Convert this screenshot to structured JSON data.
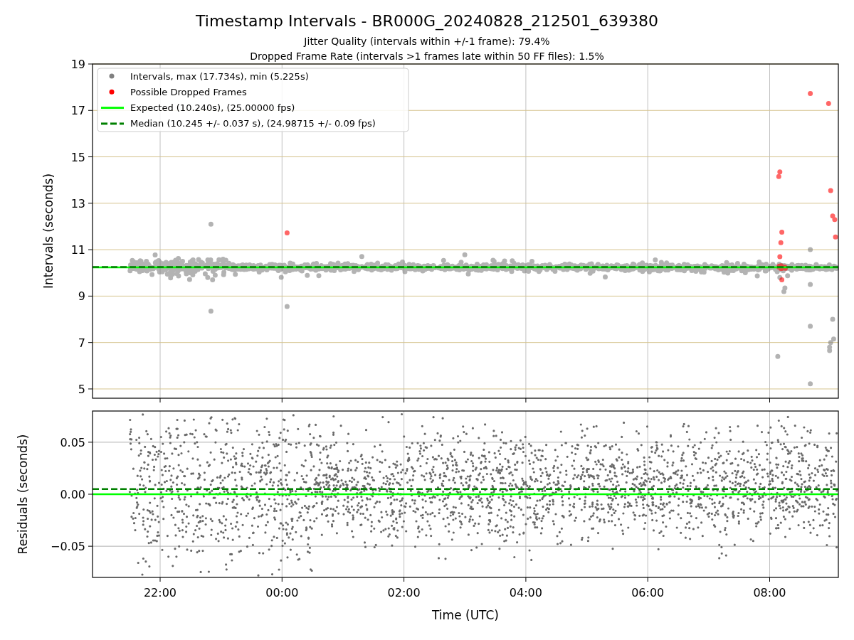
{
  "figure": {
    "title": "Timestamp Intervals - BR000G_20240828_212501_639380",
    "subtitles": [
      "Jitter Quality (intervals within +/-1 frame): 79.4%",
      "Dropped Frame Rate (intervals >1 frames late within 50 FF files): 1.5%"
    ]
  },
  "intervals_panel": {
    "legend": [
      {
        "label": "Intervals, max (17.734s), min (5.225s)",
        "color": "#808080"
      },
      {
        "label": "Possible Dropped Frames",
        "color": "#ff0000"
      },
      {
        "label": "Expected (10.240s), (25.00000 fps)",
        "color": "#00ff00"
      },
      {
        "label": "Median (10.245 +/- 0.037 s), (24.98715 +/- 0.09 fps)",
        "color": "#008000"
      }
    ],
    "chart_data": {
      "type": "scatter",
      "ylabel": "Intervals (seconds)",
      "ylim": [
        4.6,
        19
      ],
      "yticks": [
        5,
        7,
        9,
        11,
        13,
        15,
        17,
        19
      ],
      "grid": true,
      "categories": [
        null,
        null,
        null,
        null,
        null,
        null
      ],
      "ref_lines": [
        {
          "axis": "y",
          "value": 10.24,
          "color": "#00ff00"
        },
        {
          "axis": "y",
          "value": 10.25,
          "color": "#008000"
        }
      ]
    }
  },
  "residuals_panel": {
    "chart_data": {
      "type": "scatter",
      "xlabel": "Time (UTC)",
      "ylabel": "Residuals (seconds)",
      "ylim": [
        -0.08,
        0.08
      ],
      "grid": true,
      "yticks": [
        {
          "value": -0.05,
          "label": "−0.05"
        },
        {
          "value": 0,
          "label": "0.00"
        },
        {
          "value": 0.05,
          "label": "0.05"
        }
      ],
      "categories": [
        "22:00",
        "00:00",
        "02:00",
        "04:00",
        "06:00",
        "08:00"
      ],
      "ref_lines": [
        {
          "axis": "y",
          "value": 0,
          "color": "#00ff00"
        },
        {
          "axis": "y",
          "value": 0.005,
          "color": "#008000"
        }
      ]
    }
  }
}
